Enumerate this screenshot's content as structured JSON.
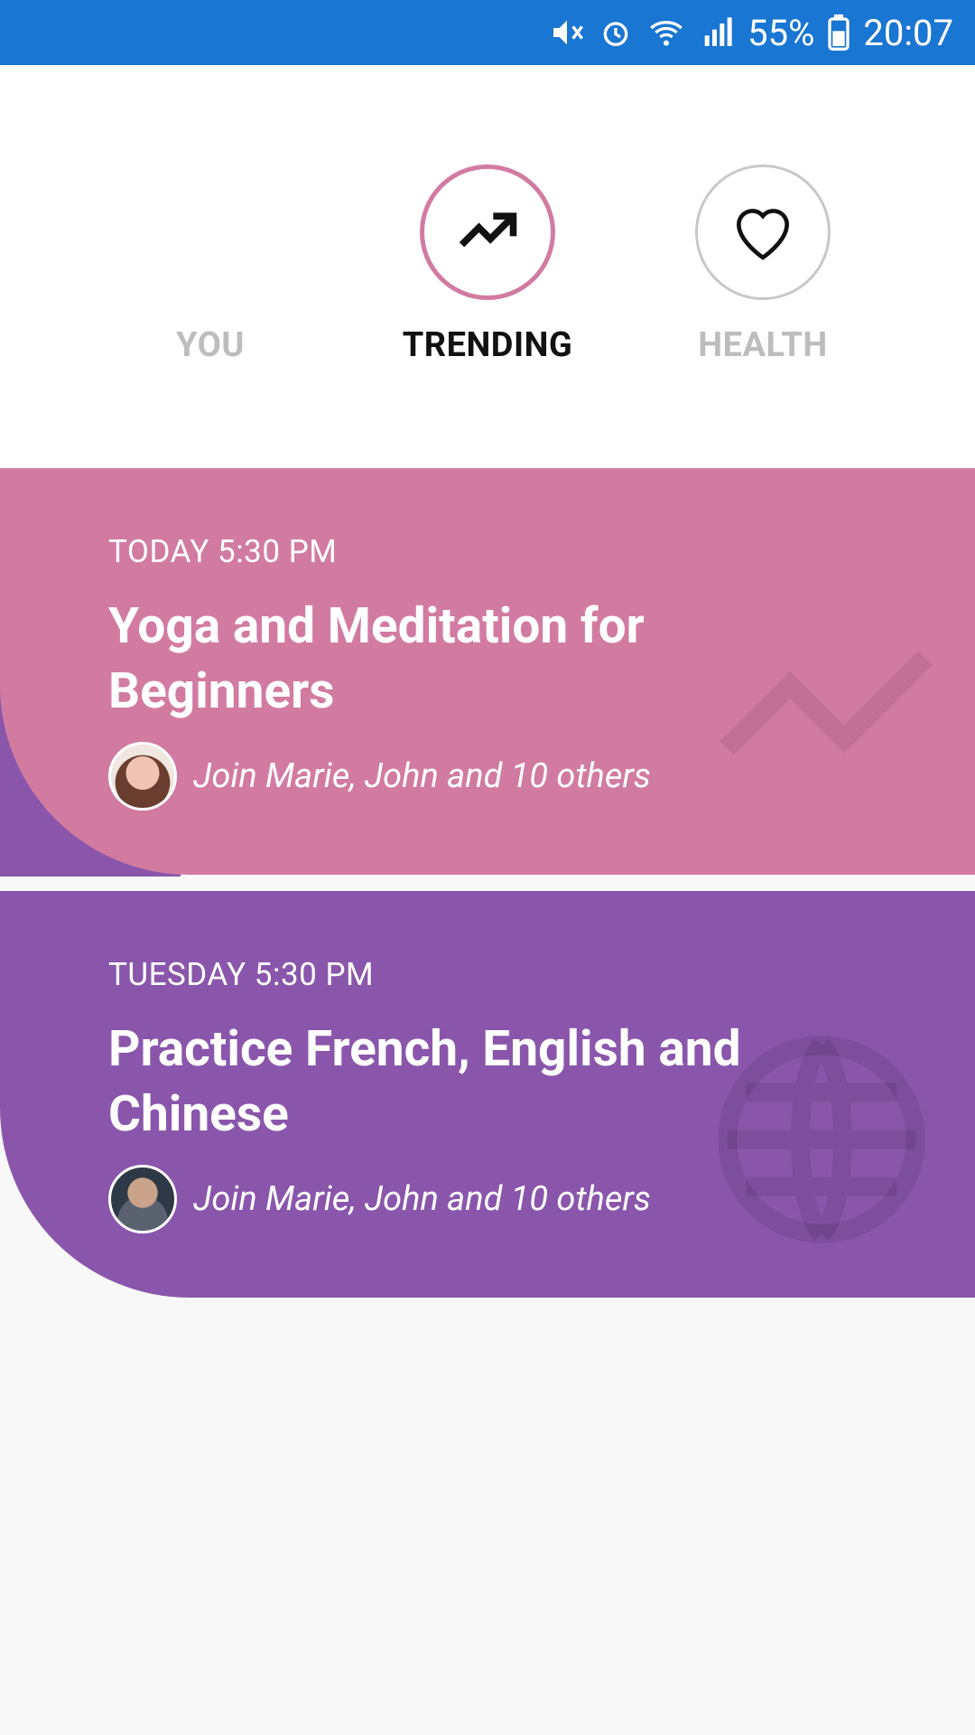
{
  "status_bar": {
    "battery": "55%",
    "time": "20:07",
    "icons": [
      "mute-icon",
      "alarm-icon",
      "wifi-icon",
      "signal-icon",
      "battery-icon"
    ]
  },
  "tabs": [
    {
      "id": "you",
      "label": "YOU",
      "icon": "user-avatar",
      "active": false
    },
    {
      "id": "trending",
      "label": "TRENDING",
      "icon": "trending-up-icon",
      "active": true
    },
    {
      "id": "health",
      "label": "HEALTH",
      "icon": "heart-icon",
      "active": false
    }
  ],
  "events": [
    {
      "when": "TODAY 5:30 PM",
      "title": "Yoga and Meditation for Beginners",
      "join_text": "Join Marie, John and 10 others",
      "color": "#d27ba1",
      "watermark_icon": "trending-up-icon"
    },
    {
      "when": "TUESDAY 5:30 PM",
      "title": "Practice French, English and Chinese",
      "join_text": "Join Marie, John and 10 others",
      "color": "#8a56ab",
      "watermark_icon": "globe-icon"
    }
  ],
  "colors": {
    "status_bar": "#1976d2",
    "trending_accent": "#d27ba1",
    "purple": "#8a56ab",
    "inactive_label": "#bdbdbd"
  }
}
